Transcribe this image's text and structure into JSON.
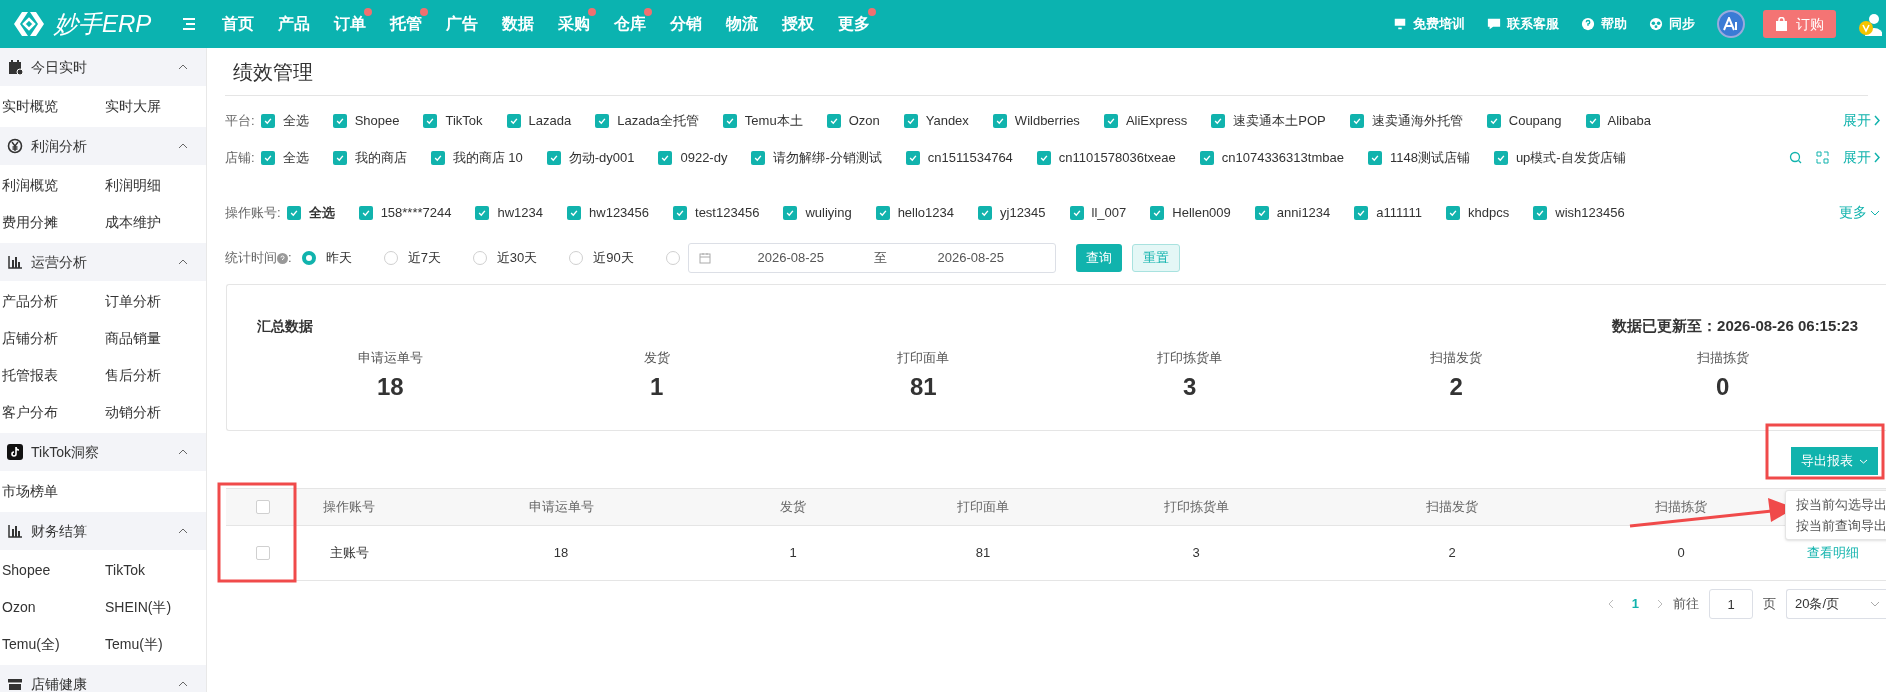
{
  "brand": "妙手ERP",
  "nav": [
    {
      "label": "首页",
      "dot": false
    },
    {
      "label": "产品",
      "dot": false
    },
    {
      "label": "订单",
      "dot": true
    },
    {
      "label": "托管",
      "dot": true
    },
    {
      "label": "广告",
      "dot": false
    },
    {
      "label": "数据",
      "dot": false
    },
    {
      "label": "采购",
      "dot": true
    },
    {
      "label": "仓库",
      "dot": true
    },
    {
      "label": "分销",
      "dot": false
    },
    {
      "label": "物流",
      "dot": false
    },
    {
      "label": "授权",
      "dot": false
    },
    {
      "label": "更多",
      "dot": true
    }
  ],
  "top_links": [
    "免费培训",
    "联系客服",
    "帮助",
    "同步"
  ],
  "order_button": "订购",
  "sidebar": [
    {
      "title": "今日实时",
      "expanded": true,
      "items": [
        "实时概览",
        "实时大屏"
      ]
    },
    {
      "title": "利润分析",
      "expanded": true,
      "items": [
        "利润概览",
        "利润明细",
        "费用分摊",
        "成本维护"
      ]
    },
    {
      "title": "运营分析",
      "expanded": true,
      "items": [
        "产品分析",
        "订单分析",
        "店铺分析",
        "商品销量",
        "托管报表",
        "售后分析",
        "客户分布",
        "动销分析"
      ]
    },
    {
      "title": "TikTok洞察",
      "expanded": true,
      "items": [
        "市场榜单"
      ]
    },
    {
      "title": "财务结算",
      "expanded": true,
      "items": [
        "Shopee",
        "TikTok",
        "Ozon",
        "SHEIN(半)",
        "Temu(全)",
        "Temu(半)"
      ]
    },
    {
      "title": "店铺健康",
      "expanded": true
    }
  ],
  "page_title": "绩效管理",
  "filters": [
    {
      "label": "平台:",
      "more": "展开",
      "tools": false,
      "options": [
        {
          "label": "全选",
          "checked": true
        },
        {
          "label": "Shopee",
          "checked": true
        },
        {
          "label": "TikTok",
          "checked": true
        },
        {
          "label": "Lazada",
          "checked": true
        },
        {
          "label": "Lazada全托管",
          "checked": true
        },
        {
          "label": "Temu本土",
          "checked": true
        },
        {
          "label": "Ozon",
          "checked": true
        },
        {
          "label": "Yandex",
          "checked": true
        },
        {
          "label": "Wildberries",
          "checked": true
        },
        {
          "label": "AliExpress",
          "checked": true
        },
        {
          "label": "速卖通本土POP",
          "checked": true
        },
        {
          "label": "速卖通海外托管",
          "checked": true
        },
        {
          "label": "Coupang",
          "checked": true
        },
        {
          "label": "Alibaba",
          "checked": true
        }
      ]
    },
    {
      "label": "店铺:",
      "more": "展开",
      "tools": true,
      "options": [
        {
          "label": "全选",
          "checked": true
        },
        {
          "label": "我的商店",
          "checked": true
        },
        {
          "label": "我的商店 10",
          "checked": true
        },
        {
          "label": "勿动-dy001",
          "checked": true
        },
        {
          "label": "0922-dy",
          "checked": true
        },
        {
          "label": "请勿解绑-分销测试",
          "checked": true
        },
        {
          "label": "cn1511534764",
          "checked": true
        },
        {
          "label": "cn1101578036txeae",
          "checked": true
        },
        {
          "label": "cn1074336313tmbae",
          "checked": true
        },
        {
          "label": "1148测试店铺",
          "checked": true
        },
        {
          "label": "up模式-自发货店铺",
          "checked": true
        }
      ]
    },
    {
      "label": "操作账号:",
      "more": "更多",
      "tools": false,
      "options": [
        {
          "label": "全选",
          "checked": true
        },
        {
          "label": "158****7244",
          "checked": true
        },
        {
          "label": "hw1234",
          "checked": true
        },
        {
          "label": "hw123456",
          "checked": true
        },
        {
          "label": "test123456",
          "checked": true
        },
        {
          "label": "wuliying",
          "checked": true
        },
        {
          "label": "hello1234",
          "checked": true
        },
        {
          "label": "yj12345",
          "checked": true
        },
        {
          "label": "ll_007",
          "checked": true
        },
        {
          "label": "Hellen009",
          "checked": true
        },
        {
          "label": "anni1234",
          "checked": true
        },
        {
          "label": "a111111",
          "checked": true
        },
        {
          "label": "khdpcs",
          "checked": true
        },
        {
          "label": "wish123456",
          "checked": true
        }
      ]
    }
  ],
  "time_filter": {
    "label": "统计时间",
    "label_suffix": ":",
    "ranges": [
      {
        "label": "昨天",
        "selected": true
      },
      {
        "label": "近7天",
        "selected": false
      },
      {
        "label": "近30天",
        "selected": false
      },
      {
        "label": "近90天",
        "selected": false
      }
    ],
    "custom_selected": false,
    "start": "2026-08-25",
    "separator": "至",
    "end": "2026-08-25",
    "query": "查询",
    "reset": "重置"
  },
  "summary": {
    "title": "汇总数据",
    "updated": "数据已更新至：2026-08-26 06:15:23",
    "stats": [
      {
        "label": "申请运单号",
        "value": "18"
      },
      {
        "label": "发货",
        "value": "1"
      },
      {
        "label": "打印面单",
        "value": "81"
      },
      {
        "label": "打印拣货单",
        "value": "3"
      },
      {
        "label": "扫描发货",
        "value": "2"
      },
      {
        "label": "扫描拣货",
        "value": "0"
      }
    ]
  },
  "export_button": "导出报表",
  "export_menu": [
    "按当前勾选导出",
    "按当前查询导出"
  ],
  "table": {
    "all_checked": false,
    "columns": [
      "操作账号",
      "申请运单号",
      "发货",
      "打印面单",
      "打印拣货单",
      "扫描发货",
      "扫描拣货"
    ],
    "rows": [
      {
        "checked": false,
        "cells": [
          "主账号",
          "18",
          "1",
          "81",
          "3",
          "2",
          "0"
        ],
        "action": "查看明细"
      }
    ]
  },
  "pagination": {
    "page": "1",
    "goto": "前往",
    "input": "1",
    "unit": "页",
    "page_size": "20条/页"
  }
}
